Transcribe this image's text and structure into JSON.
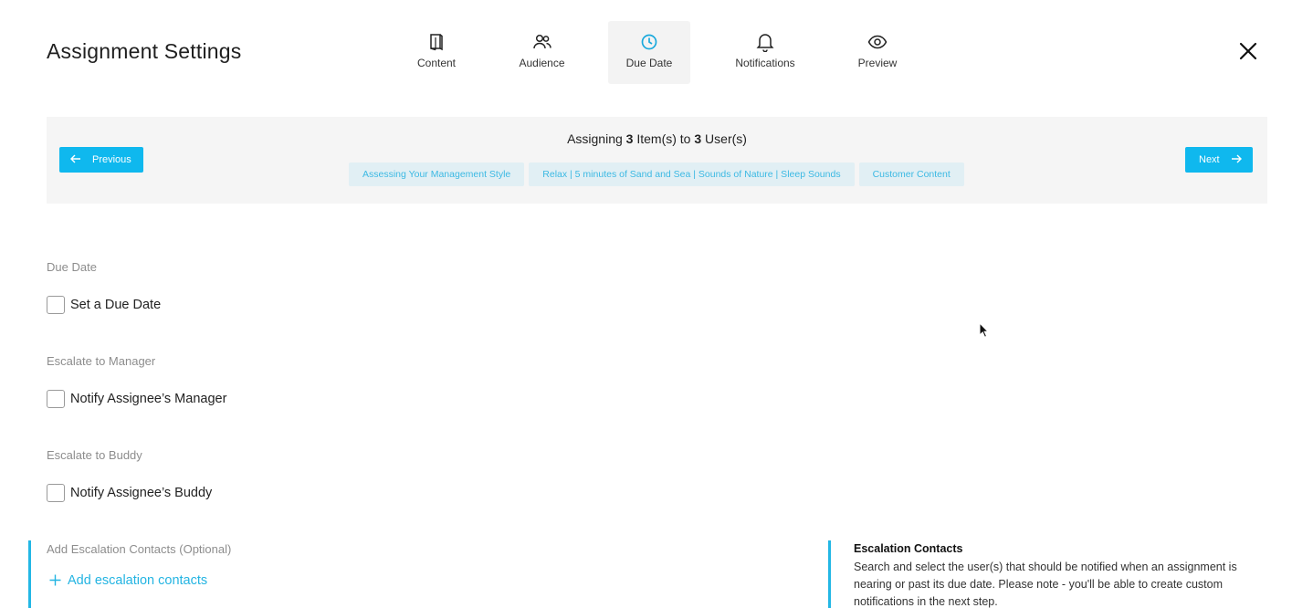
{
  "header": {
    "title": "Assignment Settings",
    "close_icon": "close-icon"
  },
  "tabs": [
    {
      "label": "Content",
      "icon": "book-icon",
      "active": false
    },
    {
      "label": "Audience",
      "icon": "users-icon",
      "active": false
    },
    {
      "label": "Due Date",
      "icon": "clock-icon",
      "active": true
    },
    {
      "label": "Notifications",
      "icon": "bell-icon",
      "active": false
    },
    {
      "label": "Preview",
      "icon": "eye-icon",
      "active": false
    }
  ],
  "banner": {
    "prev_label": "Previous",
    "next_label": "Next",
    "assign_prefix": "Assigning",
    "item_count": "3",
    "items_text": "Item(s) to",
    "user_count": "3",
    "users_text": "User(s)",
    "chips": [
      "Assessing Your Management Style",
      "Relax | 5 minutes of Sand and Sea | Sounds of Nature | Sleep Sounds",
      "Customer Content"
    ]
  },
  "sections": {
    "due_date": {
      "label": "Due Date",
      "checkbox": "Set a Due Date",
      "checked": false
    },
    "escalate_manager": {
      "label": "Escalate to Manager",
      "checkbox": "Notify Assignee’s Manager",
      "checked": false
    },
    "escalate_buddy": {
      "label": "Escalate to Buddy",
      "checkbox": "Notify Assignee’s Buddy",
      "checked": false
    },
    "escalation_contacts": {
      "label": "Add Escalation Contacts (Optional)",
      "link": "Add escalation contacts"
    }
  },
  "info": {
    "title": "Escalation Contacts",
    "body": "Search and select the user(s) that should be notified when an assignment is nearing or past its due date. Please note - you'll be able to create custom notifications in the next step."
  },
  "colors": {
    "accent": "#0fb8ee",
    "link": "#23b4e2",
    "chip_bg": "#e1eff4",
    "banner_bg": "#f5f5f5"
  }
}
